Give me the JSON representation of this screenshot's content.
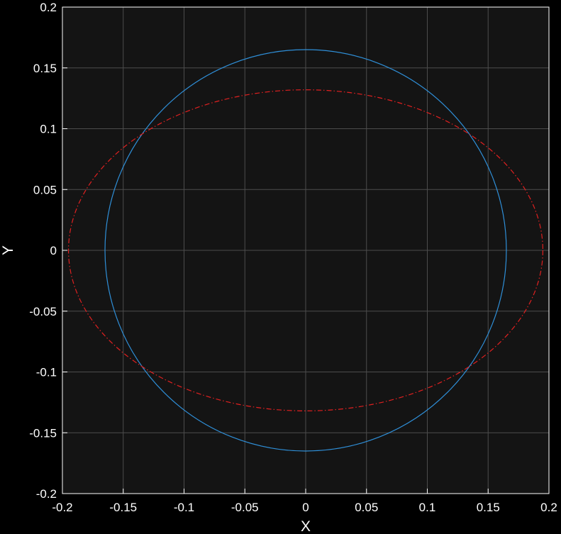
{
  "chart_data": {
    "type": "line",
    "title": "",
    "xlabel": "X",
    "ylabel": "Y",
    "xlim": [
      -0.2,
      0.2
    ],
    "ylim": [
      -0.2,
      0.2
    ],
    "xticks": [
      -0.2,
      -0.15,
      -0.1,
      -0.05,
      0,
      0.05,
      0.1,
      0.15,
      0.2
    ],
    "yticks": [
      -0.2,
      -0.15,
      -0.1,
      -0.05,
      0,
      0.05,
      0.1,
      0.15,
      0.2
    ],
    "xtick_labels": [
      "-0.2",
      "-0.15",
      "-0.1",
      "-0.05",
      "0",
      "0.05",
      "0.1",
      "0.15",
      "0.2"
    ],
    "ytick_labels": [
      "-0.2",
      "-0.15",
      "-0.1",
      "-0.05",
      "0",
      "0.05",
      "0.1",
      "0.15",
      "0.2"
    ],
    "grid": true,
    "background_color": "#141414",
    "figure_color": "#000000",
    "grid_color": "#4d4d4d",
    "series": [
      {
        "shape": "circle",
        "center": [
          0,
          0
        ],
        "radius_x": 0.165,
        "radius_y": 0.165,
        "color": "#2f8fd8",
        "line_style": "solid"
      },
      {
        "shape": "ellipse",
        "center": [
          0,
          0
        ],
        "radius_x": 0.195,
        "radius_y": 0.132,
        "color": "#e02020",
        "line_style": "dash-dot"
      }
    ]
  }
}
